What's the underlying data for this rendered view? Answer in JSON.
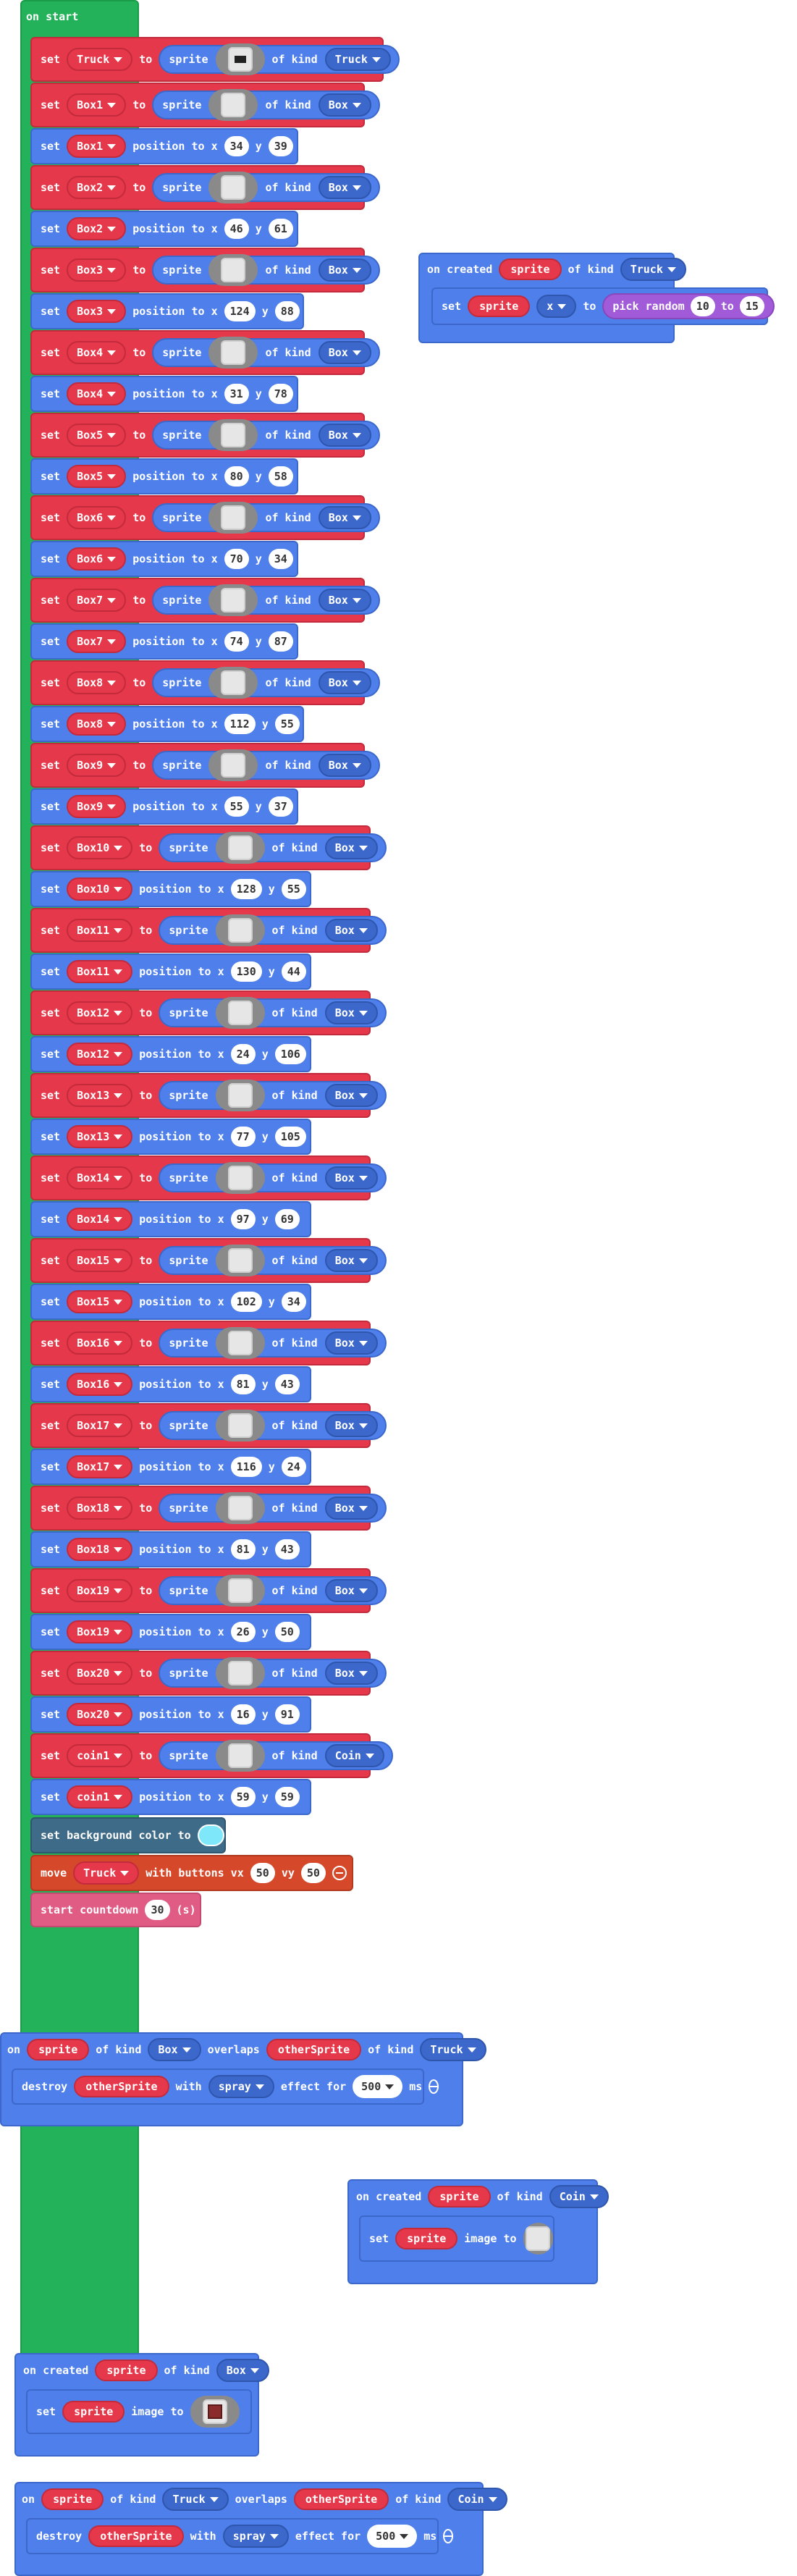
{
  "on_start": {
    "label": "on start",
    "set_label": "set",
    "to_label": "to",
    "sprite_label": "sprite",
    "of_kind_label": "of kind",
    "position_label": "position to x",
    "y_label": "y",
    "rows": [
      {
        "var": "Truck",
        "kind": "Truck",
        "x": "",
        "y": "",
        "image": "truck-icon"
      },
      {
        "var": "Box1",
        "kind": "Box",
        "x": "34",
        "y": "39"
      },
      {
        "var": "Box2",
        "kind": "Box",
        "x": "46",
        "y": "61"
      },
      {
        "var": "Box3",
        "kind": "Box",
        "x": "124",
        "y": "88"
      },
      {
        "var": "Box4",
        "kind": "Box",
        "x": "31",
        "y": "78"
      },
      {
        "var": "Box5",
        "kind": "Box",
        "x": "80",
        "y": "58"
      },
      {
        "var": "Box6",
        "kind": "Box",
        "x": "70",
        "y": "34"
      },
      {
        "var": "Box7",
        "kind": "Box",
        "x": "74",
        "y": "87"
      },
      {
        "var": "Box8",
        "kind": "Box",
        "x": "112",
        "y": "55"
      },
      {
        "var": "Box9",
        "kind": "Box",
        "x": "55",
        "y": "37"
      },
      {
        "var": "Box10",
        "kind": "Box",
        "x": "128",
        "y": "55"
      },
      {
        "var": "Box11",
        "kind": "Box",
        "x": "130",
        "y": "44"
      },
      {
        "var": "Box12",
        "kind": "Box",
        "x": "24",
        "y": "106"
      },
      {
        "var": "Box13",
        "kind": "Box",
        "x": "77",
        "y": "105"
      },
      {
        "var": "Box14",
        "kind": "Box",
        "x": "97",
        "y": "69"
      },
      {
        "var": "Box15",
        "kind": "Box",
        "x": "102",
        "y": "34"
      },
      {
        "var": "Box16",
        "kind": "Box",
        "x": "81",
        "y": "43"
      },
      {
        "var": "Box17",
        "kind": "Box",
        "x": "116",
        "y": "24"
      },
      {
        "var": "Box18",
        "kind": "Box",
        "x": "81",
        "y": "43"
      },
      {
        "var": "Box19",
        "kind": "Box",
        "x": "26",
        "y": "50"
      },
      {
        "var": "Box20",
        "kind": "Box",
        "x": "16",
        "y": "91"
      },
      {
        "var": "coin1",
        "kind": "Coin",
        "x": "59",
        "y": "59"
      }
    ],
    "bg_color_label": "set background color to",
    "bg_color": "#7ee8fa",
    "move": {
      "label": "move",
      "var": "Truck",
      "with_label": "with buttons vx",
      "vx": "50",
      "vy_label": "vy",
      "vy": "50"
    },
    "countdown": {
      "label": "start countdown",
      "value": "30",
      "unit": "(s)"
    }
  },
  "on_created_truck": {
    "label": "on created",
    "var": "sprite",
    "of_kind": "of kind",
    "kind": "Truck",
    "set": "set",
    "prop": "x",
    "to": "to",
    "fn": "pick random",
    "a": "10",
    "to2": "to",
    "b": "15"
  },
  "overlap_box": {
    "on": "on",
    "var": "sprite",
    "of_kind": "of kind",
    "kind": "Box",
    "overlaps": "overlaps",
    "other": "otherSprite",
    "of_kind2": "of kind",
    "kind2": "Truck",
    "destroy": "destroy",
    "dvar": "otherSprite",
    "with": "with",
    "effect": "spray",
    "effect_label": "effect for",
    "ms": "500",
    "ms_unit": "ms"
  },
  "on_created_coin": {
    "label": "on created",
    "var": "sprite",
    "of_kind": "of kind",
    "kind": "Coin",
    "set": "set",
    "svar": "sprite",
    "image_to": "image to"
  },
  "on_created_box": {
    "label": "on created",
    "var": "sprite",
    "of_kind": "of kind",
    "kind": "Box",
    "set": "set",
    "svar": "sprite",
    "image_to": "image to"
  },
  "overlap_coin": {
    "on": "on",
    "var": "sprite",
    "of_kind": "of kind",
    "kind": "Truck",
    "overlaps": "overlaps",
    "other": "otherSprite",
    "of_kind2": "of kind",
    "kind2": "Coin",
    "destroy": "destroy",
    "dvar": "otherSprite",
    "with": "with",
    "effect": "spray",
    "effect_label": "effect for",
    "ms": "500",
    "ms_unit": "ms"
  }
}
